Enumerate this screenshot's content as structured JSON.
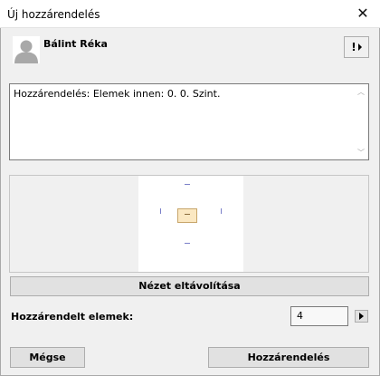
{
  "window": {
    "title": "Új hozzárendelés",
    "close_glyph": "✕"
  },
  "user": {
    "name": "Bálint Réka",
    "avatar_icon": "person-avatar-icon"
  },
  "alert_button": {
    "glyph": "!"
  },
  "description": {
    "text": "Hozzárendelés: Elemek innen: 0. 0. Szint."
  },
  "preview": {
    "remove_view_label": "Nézet eltávolítása"
  },
  "assigned": {
    "label": "Hozzárendelt elemek:",
    "count": "4"
  },
  "buttons": {
    "cancel_label": "Mégse",
    "assign_label": "Hozzárendelés"
  },
  "colors": {
    "background": "#f0f0f0",
    "button": "#e1e1e1",
    "marker": "#7a7fc8",
    "center_box": "#fbe8c2"
  }
}
